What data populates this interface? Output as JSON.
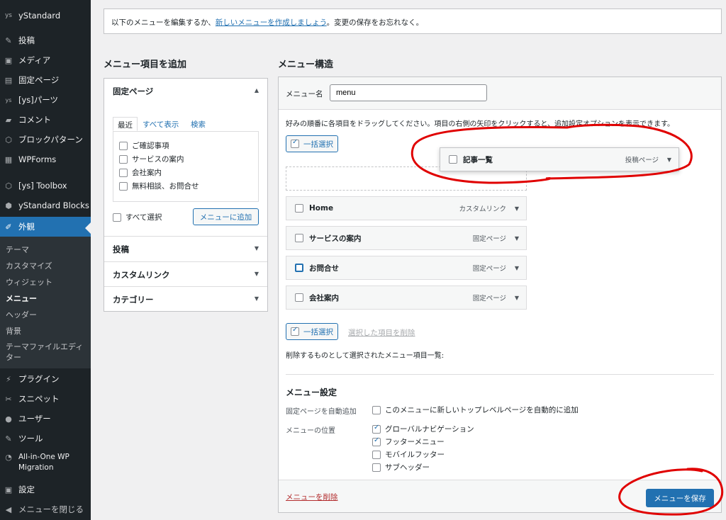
{
  "sidebar": {
    "site": "yStandard",
    "items": [
      {
        "label": "投稿",
        "icon": "pin-icon"
      },
      {
        "label": "メディア",
        "icon": "media-icon"
      },
      {
        "label": "固定ページ",
        "icon": "page-icon"
      },
      {
        "label": "[ys]パーツ",
        "icon": "ys-icon"
      },
      {
        "label": "コメント",
        "icon": "comment-icon"
      },
      {
        "label": "ブロックパターン",
        "icon": "pattern-icon"
      },
      {
        "label": "WPForms",
        "icon": "forms-icon"
      },
      {
        "label": "[ys] Toolbox",
        "icon": "toolbox-icon"
      },
      {
        "label": "yStandard Blocks",
        "icon": "blocks-icon"
      },
      {
        "label": "外観",
        "icon": "brush-icon"
      }
    ],
    "submenu": [
      "テーマ",
      "カスタマイズ",
      "ウィジェット",
      "メニュー",
      "ヘッダー",
      "背景",
      "テーマファイルエディター"
    ],
    "bottom_items": [
      {
        "label": "プラグイン",
        "icon": "plugin-icon"
      },
      {
        "label": "スニペット",
        "icon": "scissors-icon"
      },
      {
        "label": "ユーザー",
        "icon": "user-icon"
      },
      {
        "label": "ツール",
        "icon": "wrench-icon"
      },
      {
        "label": "All-in-One WP Migration",
        "icon": "migration-icon"
      },
      {
        "label": "設定",
        "icon": "settings-icon"
      },
      {
        "label": "メニューを閉じる",
        "icon": "collapse-icon"
      }
    ]
  },
  "notice": {
    "before": "以下のメニューを編集するか、",
    "link": "新しいメニューを作成しましょう",
    "after": "。変更の保存をお忘れなく。"
  },
  "left": {
    "heading": "メニュー項目を追加",
    "section_pages": "固定ページ",
    "tabs": [
      "最近",
      "すべて表示",
      "検索"
    ],
    "pages": [
      "ご確認事項",
      "サービスの案内",
      "会社案内",
      "無料相談、お問合せ"
    ],
    "select_all": "すべて選択",
    "add_button": "メニューに追加",
    "sections": [
      "投稿",
      "カスタムリンク",
      "カテゴリー"
    ]
  },
  "right": {
    "heading": "メニュー構造",
    "name_label": "メニュー名",
    "name_value": "menu",
    "instructions": "好みの順番に各項目をドラッグしてください。項目の右側の矢印をクリックすると、追加設定オプションを表示できます。",
    "bulk_select": "一括選択",
    "dragging_item": {
      "title": "記事一覧",
      "type": "投稿ページ"
    },
    "items": [
      {
        "title": "Home",
        "type": "カスタムリンク"
      },
      {
        "title": "サービスの案内",
        "type": "固定ページ"
      },
      {
        "title": "お問合せ",
        "type": "固定ページ"
      },
      {
        "title": "会社案内",
        "type": "固定ページ"
      }
    ],
    "delete_selected": "選択した項目を削除",
    "deletion_note": "削除するものとして選択されたメニュー項目一覧:",
    "settings_heading": "メニュー設定",
    "auto_add_label": "固定ページを自動追加",
    "auto_add_option": "このメニューに新しいトップレベルページを自動的に追加",
    "location_label": "メニューの位置",
    "locations": [
      {
        "label": "グローバルナビゲーション",
        "checked": true
      },
      {
        "label": "フッターメニュー",
        "checked": true
      },
      {
        "label": "モバイルフッター",
        "checked": false
      },
      {
        "label": "サブヘッダー",
        "checked": false
      }
    ],
    "delete_menu": "メニューを削除",
    "save_button": "メニューを保存"
  },
  "colors": {
    "accent": "#2271b1",
    "annotation": "#e00000",
    "sidebar": "#1d2327"
  }
}
